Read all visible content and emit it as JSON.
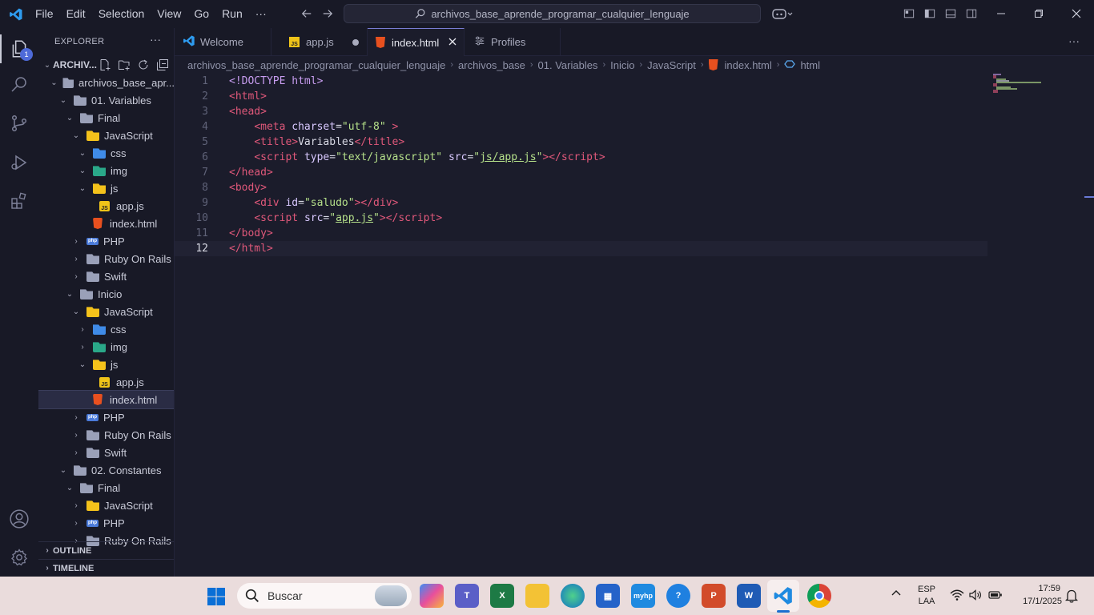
{
  "menu": [
    "File",
    "Edit",
    "Selection",
    "View",
    "Go",
    "Run",
    "···"
  ],
  "search": {
    "text": "archivos_base_aprende_programar_cualquier_lenguaje"
  },
  "explorer": {
    "title": "EXPLORER",
    "root_label": "ARCHIV...",
    "badge": "1",
    "tree": [
      {
        "label": "archivos_base_apr...",
        "type": "folder",
        "depth": 0,
        "open": true
      },
      {
        "label": "01. Variables",
        "type": "folder",
        "depth": 1,
        "open": true
      },
      {
        "label": "Final",
        "type": "folder",
        "depth": 2,
        "open": true
      },
      {
        "label": "JavaScript",
        "type": "folder-yellow",
        "depth": 3,
        "open": true
      },
      {
        "label": "css",
        "type": "folder-blue",
        "depth": 4,
        "open": true
      },
      {
        "label": "img",
        "type": "folder-teal",
        "depth": 4,
        "open": true
      },
      {
        "label": "js",
        "type": "folder-yellow",
        "depth": 4,
        "open": true
      },
      {
        "label": "app.js",
        "type": "js",
        "depth": 5
      },
      {
        "label": "index.html",
        "type": "html",
        "depth": 4
      },
      {
        "label": "PHP",
        "type": "php",
        "depth": 3,
        "open": false
      },
      {
        "label": "Ruby On Rails",
        "type": "folder",
        "depth": 3,
        "open": false
      },
      {
        "label": "Swift",
        "type": "folder",
        "depth": 3,
        "open": false
      },
      {
        "label": "Inicio",
        "type": "folder",
        "depth": 2,
        "open": true
      },
      {
        "label": "JavaScript",
        "type": "folder-yellow",
        "depth": 3,
        "open": true
      },
      {
        "label": "css",
        "type": "folder-blue",
        "depth": 4,
        "open": false
      },
      {
        "label": "img",
        "type": "folder-teal",
        "depth": 4,
        "open": false
      },
      {
        "label": "js",
        "type": "folder-yellow",
        "depth": 4,
        "open": true
      },
      {
        "label": "app.js",
        "type": "js",
        "depth": 5
      },
      {
        "label": "index.html",
        "type": "html",
        "depth": 4,
        "selected": true
      },
      {
        "label": "PHP",
        "type": "php",
        "depth": 3,
        "open": false
      },
      {
        "label": "Ruby On Rails",
        "type": "folder",
        "depth": 3,
        "open": false
      },
      {
        "label": "Swift",
        "type": "folder",
        "depth": 3,
        "open": false
      },
      {
        "label": "02. Constantes",
        "type": "folder",
        "depth": 1,
        "open": true
      },
      {
        "label": "Final",
        "type": "folder",
        "depth": 2,
        "open": true
      },
      {
        "label": "JavaScript",
        "type": "folder-yellow",
        "depth": 3,
        "open": false
      },
      {
        "label": "PHP",
        "type": "php",
        "depth": 3,
        "open": false
      },
      {
        "label": "Ruby On Rails",
        "type": "folder",
        "depth": 3,
        "open": false
      }
    ],
    "outline": "OUTLINE",
    "timeline": "TIMELINE"
  },
  "tabs": [
    {
      "label": "Welcome",
      "icon": "vscode-icon"
    },
    {
      "label": "app.js",
      "icon": "js-icon",
      "dirty": true
    },
    {
      "label": "index.html",
      "icon": "html-icon",
      "active": true
    },
    {
      "label": "Profiles",
      "icon": "profiles-icon"
    }
  ],
  "breadcrumb": [
    "archivos_base_aprende_programar_cualquier_lenguaje",
    "archivos_base",
    "01. Variables",
    "Inicio",
    "JavaScript",
    "index.html",
    "html"
  ],
  "code": {
    "current_line": 12,
    "lines": [
      [
        [
          "t-doctype",
          "<!DOCTYPE html>"
        ]
      ],
      [
        [
          "t-punc",
          "<"
        ],
        [
          "t-tag",
          "html"
        ],
        [
          "t-punc",
          ">"
        ]
      ],
      [
        [
          "t-punc",
          "<"
        ],
        [
          "t-tag",
          "head"
        ],
        [
          "t-punc",
          ">"
        ]
      ],
      [
        [
          "t-txt",
          "    "
        ],
        [
          "t-punc",
          "<"
        ],
        [
          "t-tag",
          "meta "
        ],
        [
          "t-attr",
          "charset"
        ],
        [
          "t-txt",
          "="
        ],
        [
          "t-str",
          "\"utf-8\""
        ],
        [
          "t-txt",
          " "
        ],
        [
          "t-punc",
          ">"
        ]
      ],
      [
        [
          "t-txt",
          "    "
        ],
        [
          "t-punc",
          "<"
        ],
        [
          "t-tag",
          "title"
        ],
        [
          "t-punc",
          ">"
        ],
        [
          "t-txt",
          "Variables"
        ],
        [
          "t-punc",
          "</"
        ],
        [
          "t-tag",
          "title"
        ],
        [
          "t-punc",
          ">"
        ]
      ],
      [
        [
          "t-txt",
          "    "
        ],
        [
          "t-punc",
          "<"
        ],
        [
          "t-tag",
          "script "
        ],
        [
          "t-attr",
          "type"
        ],
        [
          "t-txt",
          "="
        ],
        [
          "t-str",
          "\"text/javascript\""
        ],
        [
          "t-txt",
          " "
        ],
        [
          "t-attr",
          "src"
        ],
        [
          "t-txt",
          "="
        ],
        [
          "t-str",
          "\""
        ],
        [
          "t-link",
          "js/app.js"
        ],
        [
          "t-str",
          "\""
        ],
        [
          "t-punc",
          "></"
        ],
        [
          "t-tag",
          "script"
        ],
        [
          "t-punc",
          ">"
        ]
      ],
      [
        [
          "t-punc",
          "</"
        ],
        [
          "t-tag",
          "head"
        ],
        [
          "t-punc",
          ">"
        ]
      ],
      [
        [
          "t-punc",
          "<"
        ],
        [
          "t-tag",
          "body"
        ],
        [
          "t-punc",
          ">"
        ]
      ],
      [
        [
          "t-txt",
          "    "
        ],
        [
          "t-punc",
          "<"
        ],
        [
          "t-tag",
          "div "
        ],
        [
          "t-attr",
          "id"
        ],
        [
          "t-txt",
          "="
        ],
        [
          "t-str",
          "\"saludo\""
        ],
        [
          "t-punc",
          "></"
        ],
        [
          "t-tag",
          "div"
        ],
        [
          "t-punc",
          ">"
        ]
      ],
      [
        [
          "t-txt",
          "    "
        ],
        [
          "t-punc",
          "<"
        ],
        [
          "t-tag",
          "script "
        ],
        [
          "t-attr",
          "src"
        ],
        [
          "t-txt",
          "="
        ],
        [
          "t-str",
          "\""
        ],
        [
          "t-link",
          "app.js"
        ],
        [
          "t-str",
          "\""
        ],
        [
          "t-punc",
          "></"
        ],
        [
          "t-tag",
          "script"
        ],
        [
          "t-punc",
          ">"
        ]
      ],
      [
        [
          "t-punc",
          "</"
        ],
        [
          "t-tag",
          "body"
        ],
        [
          "t-punc",
          ">"
        ]
      ],
      [
        [
          "t-punc",
          "</"
        ],
        [
          "t-tag",
          "html"
        ],
        [
          "t-punc",
          ">"
        ]
      ]
    ]
  },
  "taskbar": {
    "search_placeholder": "Buscar",
    "lang1": "ESP",
    "lang2": "LAA",
    "time": "17:59",
    "date": "17/1/2025"
  }
}
